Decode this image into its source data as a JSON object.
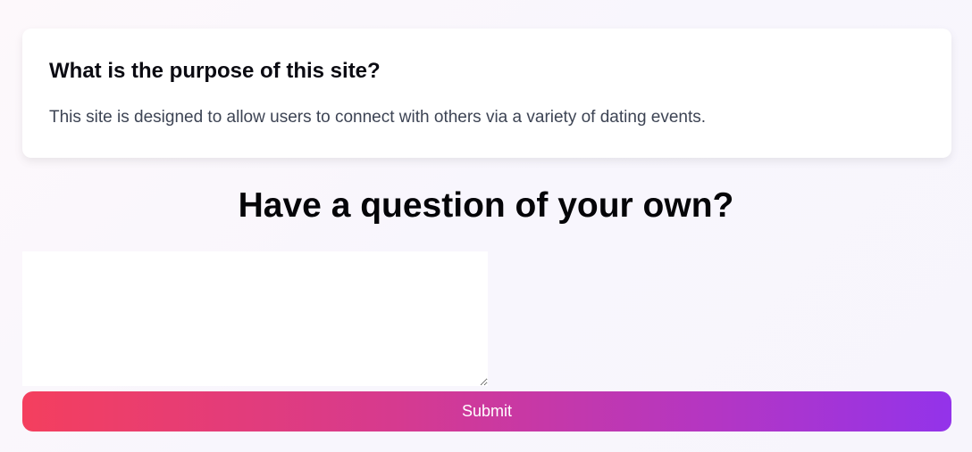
{
  "faq": {
    "question": "What is the purpose of this site?",
    "answer": "This site is designed to allow users to connect with others via a variety of dating events."
  },
  "ask_section": {
    "heading": "Have a question of your own?",
    "input_value": "",
    "input_placeholder": "",
    "submit_label": "Submit"
  },
  "colors": {
    "button_gradient_start": "#f43f5e",
    "button_gradient_end": "#9333ea",
    "card_background": "#ffffff"
  }
}
